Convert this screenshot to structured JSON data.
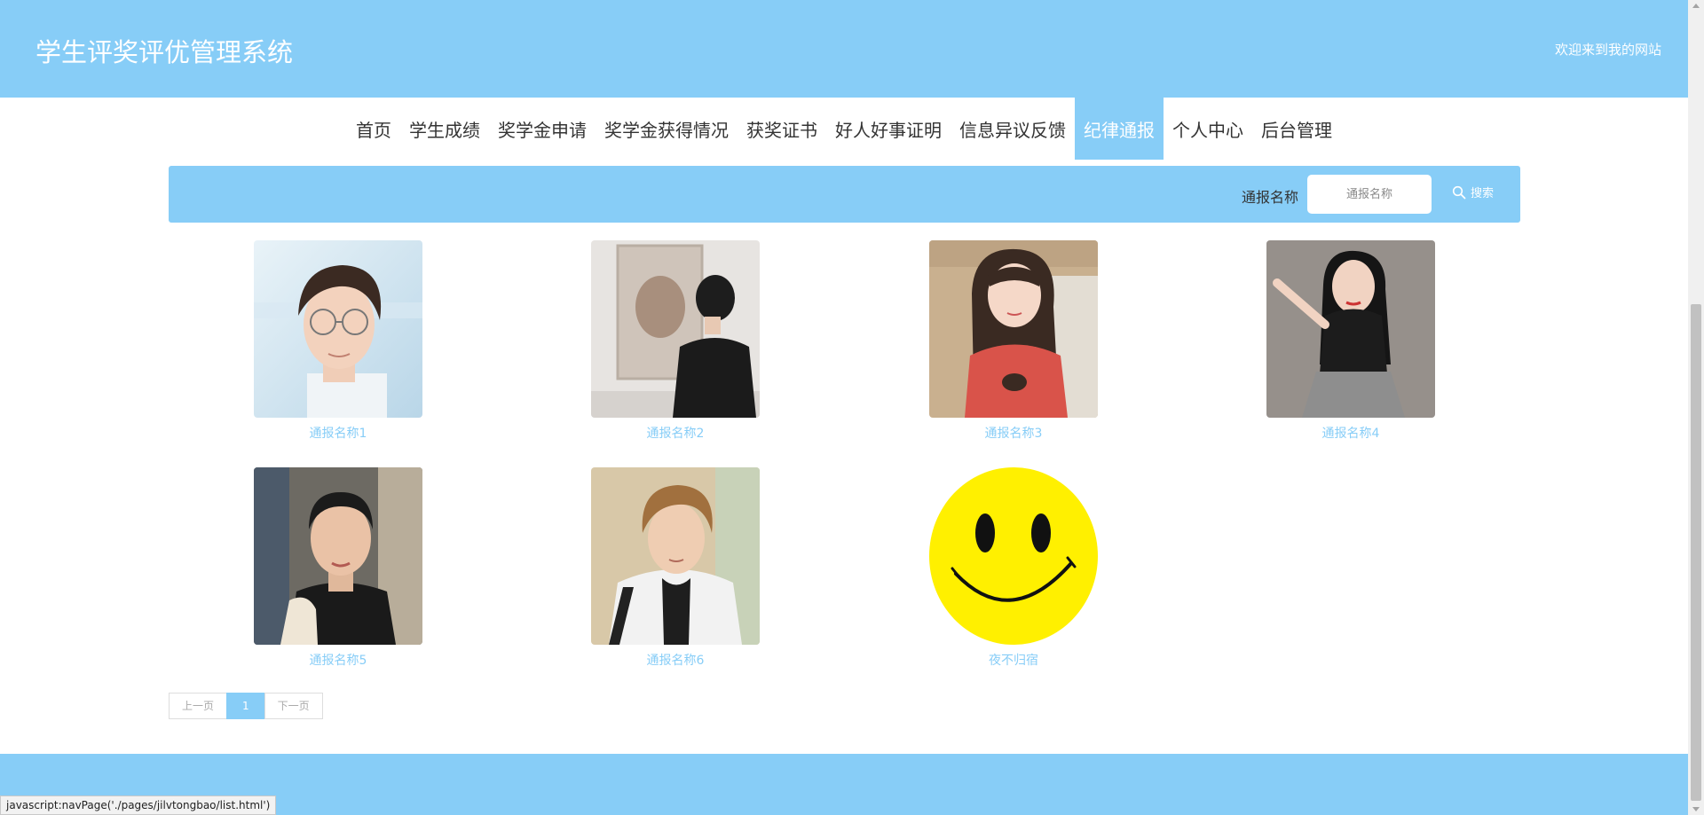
{
  "header": {
    "title": "学生评奖评优管理系统",
    "welcome": "欢迎来到我的网站"
  },
  "nav": {
    "items": [
      {
        "label": "首页"
      },
      {
        "label": "学生成绩"
      },
      {
        "label": "奖学金申请"
      },
      {
        "label": "奖学金获得情况"
      },
      {
        "label": "获奖证书"
      },
      {
        "label": "好人好事证明"
      },
      {
        "label": "信息异议反馈"
      },
      {
        "label": "纪律通报",
        "active": true
      },
      {
        "label": "个人中心"
      },
      {
        "label": "后台管理"
      }
    ]
  },
  "search": {
    "label": "通报名称",
    "placeholder": "通报名称",
    "button_label": "搜索",
    "icon": "search-icon"
  },
  "cards": [
    {
      "title": "通报名称1",
      "image": "photo-young-man-glasses"
    },
    {
      "title": "通报名称2",
      "image": "photo-man-back-view-gallery"
    },
    {
      "title": "通报名称3",
      "image": "photo-girl-red-shirt"
    },
    {
      "title": "通报名称4",
      "image": "photo-girl-black-top"
    },
    {
      "title": "通报名称5",
      "image": "photo-young-man-towel"
    },
    {
      "title": "通报名称6",
      "image": "photo-young-man-jacket"
    },
    {
      "title": "夜不归宿",
      "image": "smiley-face-icon"
    }
  ],
  "pagination": {
    "prev": "上一页",
    "current": "1",
    "next": "下一页"
  },
  "status_bar": {
    "text": "javascript:navPage('./pages/jilvtongbao/list.html')"
  },
  "colors": {
    "primary": "#87cdf7",
    "text_dark": "#333333",
    "white": "#ffffff"
  }
}
